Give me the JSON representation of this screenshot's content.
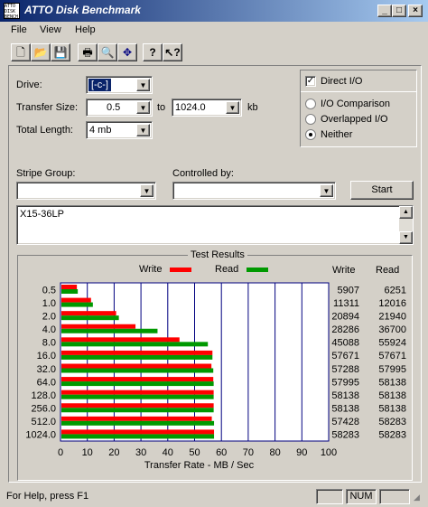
{
  "window": {
    "title": "ATTO Disk Benchmark",
    "icon_text": "ATTO DISK BENCH"
  },
  "menu": [
    "File",
    "View",
    "Help"
  ],
  "toolbar": [
    "new-icon",
    "open-icon",
    "save-icon",
    "print-icon",
    "print-preview-icon",
    "move-icon",
    "help-icon",
    "context-help-icon"
  ],
  "form": {
    "drive_label": "Drive:",
    "drive_value": "[-c-]",
    "transfer_label": "Transfer Size:",
    "transfer_from": "0.5",
    "to_label": "to",
    "transfer_to": "1024.0",
    "kb_label": "kb",
    "length_label": "Total Length:",
    "length_value": "4 mb",
    "direct_io_label": "Direct I/O",
    "direct_io_checked": true,
    "io_comparison_label": "I/O Comparison",
    "overlapped_label": "Overlapped I/O",
    "neither_label": "Neither",
    "selected_mode": "neither",
    "stripe_label": "Stripe Group:",
    "controlled_label": "Controlled by:",
    "start_label": "Start",
    "description": "X15-36LP"
  },
  "results": {
    "title": "Test Results",
    "write_legend": "Write",
    "read_legend": "Read",
    "write_col": "Write",
    "read_col": "Read",
    "write_color": "#ff0000",
    "read_color": "#009900"
  },
  "chart_data": {
    "type": "bar",
    "orientation": "horizontal",
    "xlabel": "Transfer Rate - MB / Sec",
    "xlim": [
      0,
      100
    ],
    "xticks": [
      "0",
      "10",
      "20",
      "30",
      "40",
      "50",
      "60",
      "70",
      "80",
      "90",
      "100"
    ],
    "categories": [
      "0.5",
      "1.0",
      "2.0",
      "4.0",
      "8.0",
      "16.0",
      "32.0",
      "64.0",
      "128.0",
      "256.0",
      "512.0",
      "1024.0"
    ],
    "series": [
      {
        "name": "Write",
        "values": [
          5907,
          11311,
          20894,
          28286,
          45088,
          57671,
          57288,
          57995,
          58138,
          58138,
          57428,
          58283
        ]
      },
      {
        "name": "Read",
        "values": [
          6251,
          12016,
          21940,
          36700,
          55924,
          57671,
          57995,
          58138,
          58138,
          58138,
          58283,
          58283
        ]
      }
    ],
    "write_display": [
      "5907",
      "11311",
      "20894",
      "28286",
      "45088",
      "57671",
      "57288",
      "57995",
      "58138",
      "58138",
      "57428",
      "58283"
    ],
    "read_display": [
      "6251",
      "12016",
      "21940",
      "36700",
      "55924",
      "57671",
      "57995",
      "58138",
      "58138",
      "58138",
      "58283",
      "58283"
    ]
  },
  "status": {
    "help": "For Help, press F1",
    "num": "NUM"
  }
}
